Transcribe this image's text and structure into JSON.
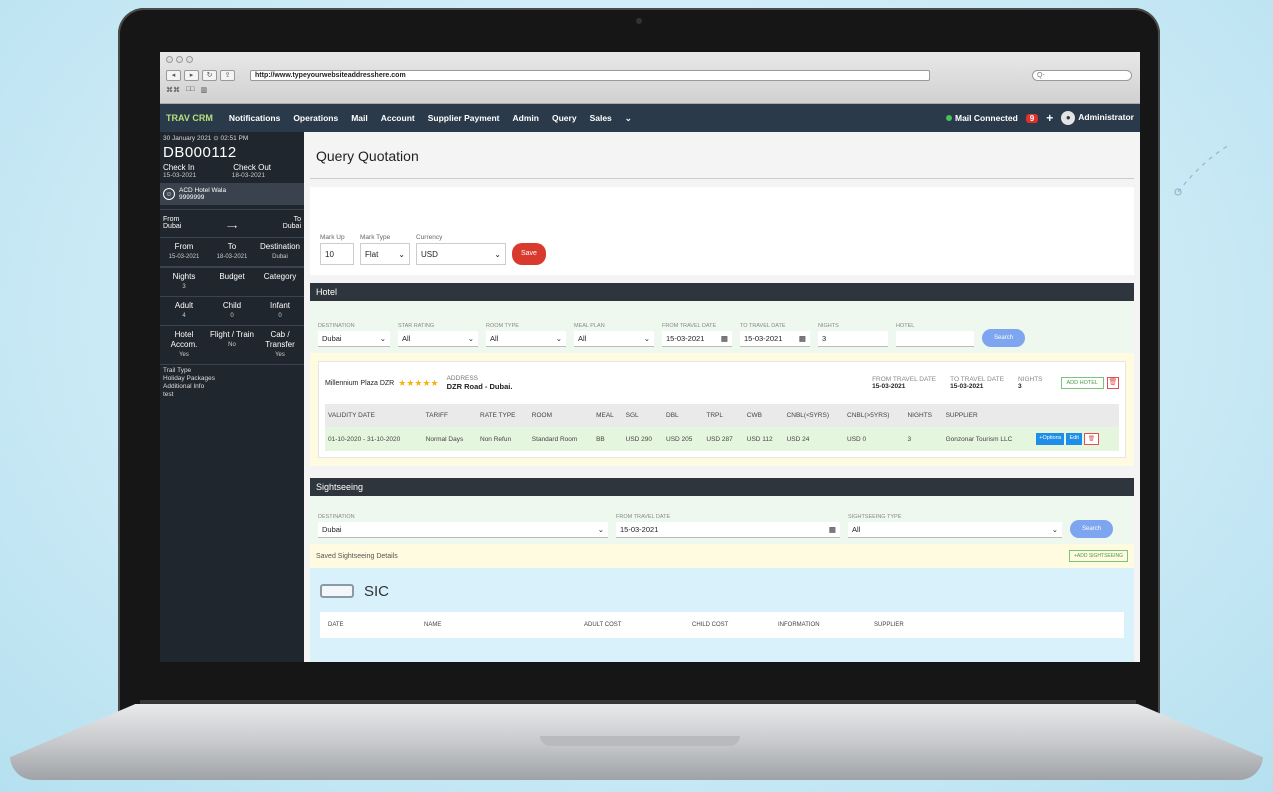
{
  "browser": {
    "url": "http://www.typeyourwebsiteaddresshere.com",
    "search_placeholder": "Q-",
    "bookmarks": [
      "⌘⌘",
      "□□",
      "▥"
    ]
  },
  "nav": {
    "logo": "TRAV CRM",
    "items": [
      "Notifications",
      "Operations",
      "Mail",
      "Account",
      "Supplier Payment",
      "Admin",
      "Query",
      "Sales"
    ],
    "mail_status": "Mail Connected",
    "badge": "9",
    "plus": "+",
    "user": "Administrator"
  },
  "sidebar": {
    "datetime": "30 January 2021 ⊙ 02:51 PM",
    "query_code": "DB000112",
    "check_in_label": "Check In",
    "check_out_label": "Check Out",
    "check_in_date": "15-03-2021",
    "check_out_date": "18-03-2021",
    "agent_name": "ACD Hotel Wala",
    "agent_phone": "9999999",
    "from_label": "From",
    "to_label": "To",
    "from_value": "Dubai",
    "arrow": "⟶",
    "to_value": "Dubai",
    "route_headers": [
      "From",
      "To",
      "Destination"
    ],
    "route_values": [
      "15-03-2021",
      "18-03-2021",
      "Dubai"
    ],
    "stats": [
      {
        "label": "Nights",
        "value": "3"
      },
      {
        "label": "Budget",
        "value": ""
      },
      {
        "label": "Category",
        "value": ""
      },
      {
        "label": "Adult",
        "value": "4"
      },
      {
        "label": "Child",
        "value": "0"
      },
      {
        "label": "Infant",
        "value": "0"
      },
      {
        "label": "Hotel Accom.",
        "value": "Yes"
      },
      {
        "label": "Flight / Train",
        "value": "No"
      },
      {
        "label": "Cab / Transfer",
        "value": "Yes"
      }
    ],
    "footer_lines": [
      "Trail Type",
      "Holiday Packages",
      "Additional Info",
      "test"
    ]
  },
  "quotation": {
    "title": "Query Quotation",
    "markup_label": "Mark Up",
    "markup_value": "10",
    "marktype_label": "Mark Type",
    "marktype_value": "Flat",
    "currency_label": "Currency",
    "currency_value": "USD",
    "save_label": "Save"
  },
  "hotel": {
    "section_title": "Hotel",
    "filters": [
      {
        "label": "DESTINATION",
        "value": "Dubai"
      },
      {
        "label": "STAR RATING",
        "value": "All"
      },
      {
        "label": "ROOM TYPE",
        "value": "All"
      },
      {
        "label": "MEAL PLAN",
        "value": "All"
      },
      {
        "label": "FROM TRAVEL DATE",
        "value": "15-03-2021"
      },
      {
        "label": "TO TRAVEL DATE",
        "value": "15-03-2021"
      },
      {
        "label": "NIGHTS",
        "value": "3"
      },
      {
        "label": "HOTEL",
        "value": ""
      }
    ],
    "search_label": "Search",
    "card": {
      "name": "Millennium Plaza DZR",
      "stars": "★★★★★",
      "address_label": "ADDRESS",
      "address": "DZR Road - Dubai.",
      "from_label": "FROM TRAVEL DATE",
      "from_value": "15-03-2021",
      "to_label": "TO TRAVEL DATE",
      "to_value": "15-03-2021",
      "nights_label": "NIGHTS",
      "nights_value": "3",
      "add_button": "ADD HOTEL",
      "delete_icon": "🗑"
    },
    "table": {
      "headers": [
        "VALIDITY DATE",
        "TARIFF",
        "RATE TYPE",
        "ROOM",
        "MEAL",
        "SGL",
        "DBL",
        "TRPL",
        "CWB",
        "CNBL(<5YRS)",
        "CNBL(>5YRS)",
        "NIGHTS",
        "SUPPLIER",
        ""
      ],
      "row": [
        "01-10-2020 - 31-10-2020",
        "Normal Days",
        "Non Refun",
        "Standard Room",
        "BB",
        "USD 290",
        "USD 205",
        "USD 287",
        "USD 112",
        "USD 24",
        "USD 0",
        "3",
        "Gonzonar Tourism LLC",
        ""
      ],
      "actions": [
        "+Options",
        "Edit",
        "🗑"
      ]
    }
  },
  "sightseeing": {
    "section_title": "Sightseeing",
    "destination_label": "DESTINATION",
    "destination_value": "Dubai",
    "from_label": "FROM TRAVEL DATE",
    "from_value": "15-03-2021",
    "type_label": "SIGHTSEEING TYPE",
    "type_value": "All",
    "search_label": "Search",
    "saved_label": "Saved Sightseeing Details",
    "add_button": "+ADD SIGHTSEEING",
    "sic_label": "SIC",
    "table_headers": [
      "DATE",
      "NAME",
      "ADULT COST",
      "CHILD COST",
      "INFORMATION",
      "SUPPLIER"
    ]
  }
}
